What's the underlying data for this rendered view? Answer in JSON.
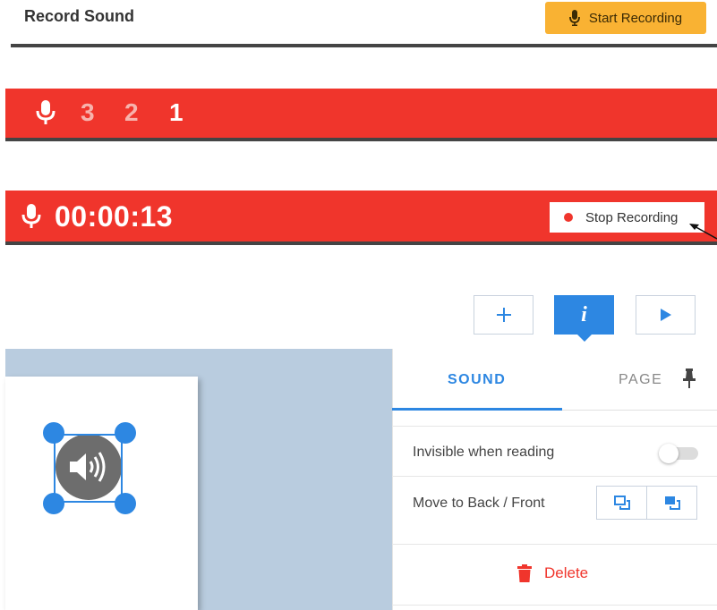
{
  "header": {
    "title": "Record Sound",
    "start_button": "Start Recording",
    "accent": "#f9b233"
  },
  "countdown": {
    "numbers": [
      "3",
      "2",
      "1"
    ],
    "bar_color": "#f0352c"
  },
  "recording": {
    "timer": "00:00:13",
    "stop_button": "Stop Recording"
  },
  "toolbar": {
    "add_icon": "plus-icon",
    "info_icon": "info-icon",
    "play_icon": "play-icon",
    "info_glyph": "i"
  },
  "panel": {
    "tabs": [
      {
        "label": "SOUND",
        "active": true
      },
      {
        "label": "PAGE",
        "active": false
      }
    ],
    "pin_icon": "pin-icon",
    "invisible_label": "Invisible when reading",
    "invisible_on": false,
    "order_label": "Move to Back / Front",
    "delete_label": "Delete"
  },
  "canvas": {
    "element_icon": "speaker-icon"
  }
}
